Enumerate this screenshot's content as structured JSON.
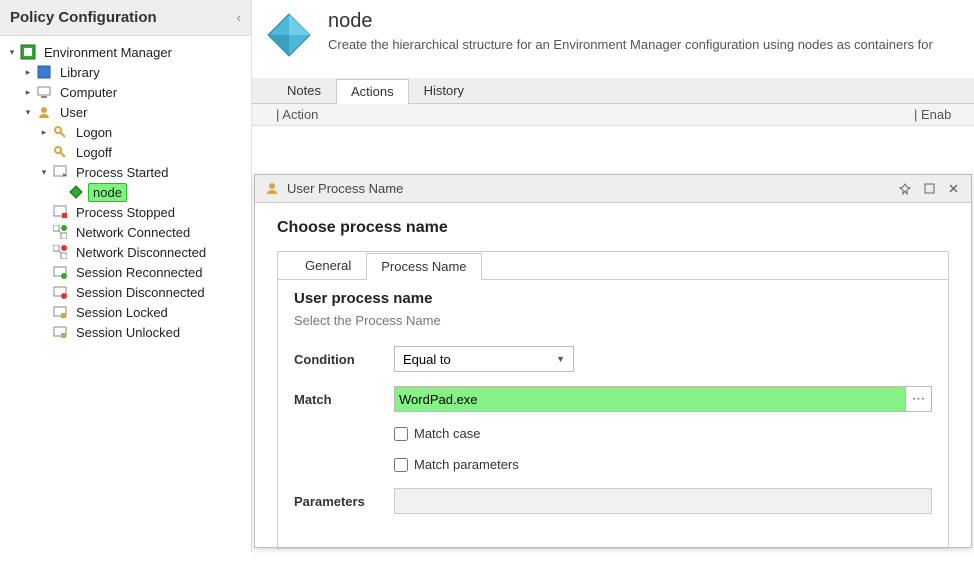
{
  "sidebar": {
    "title": "Policy Configuration",
    "tree": {
      "root": "Environment Manager",
      "library": "Library",
      "computer": "Computer",
      "user": "User",
      "logon": "Logon",
      "logoff": "Logoff",
      "process_started": "Process Started",
      "node": "node",
      "process_stopped": "Process Stopped",
      "network_connected": "Network Connected",
      "network_disconnected": "Network Disconnected",
      "session_reconnected": "Session Reconnected",
      "session_disconnected": "Session Disconnected",
      "session_locked": "Session Locked",
      "session_unlocked": "Session Unlocked"
    }
  },
  "main": {
    "title": "node",
    "description": "Create the hierarchical structure for an Environment Manager configuration using nodes as containers for",
    "tabs": {
      "notes": "Notes",
      "actions": "Actions",
      "history": "History",
      "active": "actions"
    },
    "columns": {
      "action": "| Action",
      "enabled": "| Enab"
    }
  },
  "dialog": {
    "title": "User Process Name",
    "heading": "Choose process name",
    "tabs": {
      "general": "General",
      "process_name": "Process Name",
      "active": "process_name"
    },
    "panel": {
      "title": "User process name",
      "subtitle": "Select the Process Name",
      "condition_label": "Condition",
      "condition_value": "Equal to",
      "match_label": "Match",
      "match_value": "WordPad.exe",
      "match_case_label": "Match case",
      "match_case_checked": false,
      "match_params_label": "Match parameters",
      "match_params_checked": false,
      "parameters_label": "Parameters",
      "parameters_value": ""
    }
  },
  "colors": {
    "accent_green": "#86f286"
  }
}
